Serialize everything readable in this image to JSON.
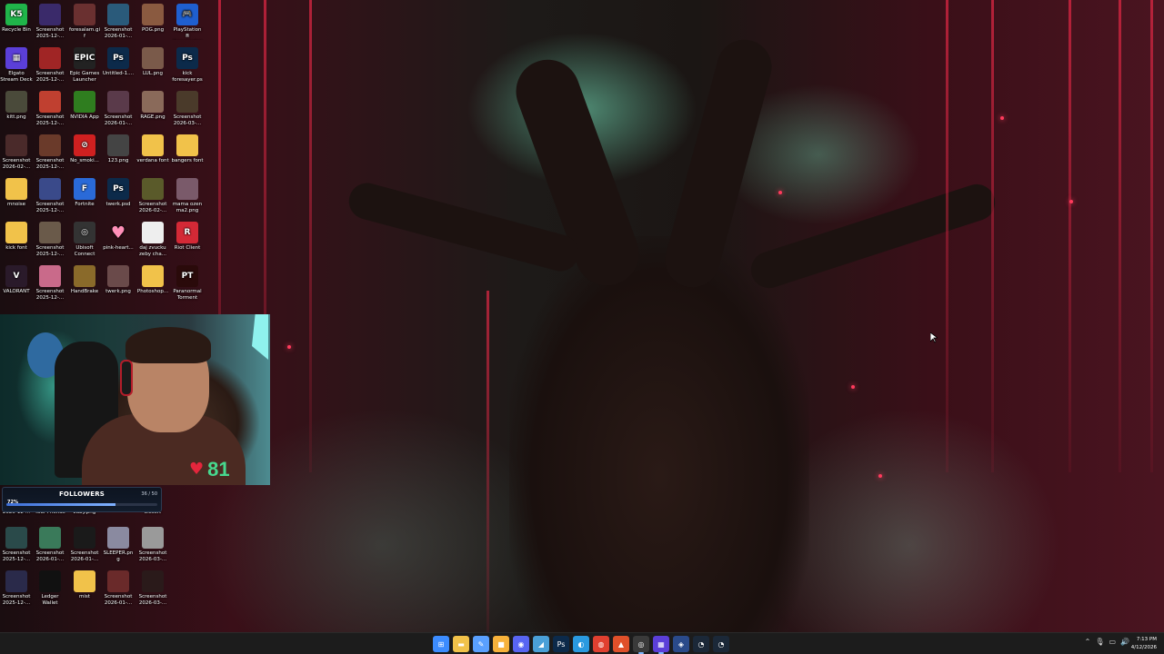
{
  "desktop": {
    "icons": [
      {
        "label": "Recycle Bin",
        "glyph": "K5",
        "color": "#20b54a",
        "icon": "recycle-bin-icon"
      },
      {
        "label": "Screenshot 2025-12-...",
        "glyph": "",
        "color": "#3a2a6a",
        "icon": "screenshot-icon"
      },
      {
        "label": "foresalam.gif",
        "glyph": "",
        "color": "#6a3030",
        "icon": "gif-file-icon"
      },
      {
        "label": "Screenshot 2026-01-...",
        "glyph": "",
        "color": "#2a5a7a",
        "icon": "screenshot-icon"
      },
      {
        "label": "POG.png",
        "glyph": "",
        "color": "#8a5a40",
        "icon": "image-file-icon"
      },
      {
        "label": "PlayStation® Accessories",
        "glyph": "🎮",
        "color": "#1f5fcf",
        "icon": "playstation-icon"
      },
      {
        "label": "Elgato Stream Deck",
        "glyph": "▦",
        "color": "#5b3fd8",
        "icon": "stream-deck-icon"
      },
      {
        "label": "Screenshot 2025-12-...",
        "glyph": "",
        "color": "#a02525",
        "icon": "screenshot-icon"
      },
      {
        "label": "Epic Games Launcher",
        "glyph": "EPIC",
        "color": "#222222",
        "icon": "epic-games-icon"
      },
      {
        "label": "Untitled-1....",
        "glyph": "Ps",
        "color": "#0c2a4a",
        "icon": "photoshop-file-icon"
      },
      {
        "label": "LUL.png",
        "glyph": "",
        "color": "#7a5a4a",
        "icon": "image-file-icon"
      },
      {
        "label": "kick foresayer.psd",
        "glyph": "Ps",
        "color": "#0c2a4a",
        "icon": "photoshop-file-icon"
      },
      {
        "label": "kitt.png",
        "glyph": "",
        "color": "#4a4a3a",
        "icon": "image-file-icon"
      },
      {
        "label": "Screenshot 2025-12-...",
        "glyph": "",
        "color": "#c04030",
        "icon": "screenshot-icon"
      },
      {
        "label": "NVIDIA App",
        "glyph": "",
        "color": "#2f7d1f",
        "icon": "nvidia-icon"
      },
      {
        "label": "Screenshot 2026-01-...",
        "glyph": "",
        "color": "#5a3a4a",
        "icon": "screenshot-icon"
      },
      {
        "label": "RAGE.png",
        "glyph": "",
        "color": "#8a6a5a",
        "icon": "image-file-icon"
      },
      {
        "label": "Screenshot 2026-03-...",
        "glyph": "",
        "color": "#4a3a2a",
        "icon": "screenshot-icon"
      },
      {
        "label": "Screenshot 2026-02-...",
        "glyph": "",
        "color": "#4a2a2a",
        "icon": "screenshot-icon"
      },
      {
        "label": "Screenshot 2025-12-...",
        "glyph": "",
        "color": "#6a3a2a",
        "icon": "screenshot-icon"
      },
      {
        "label": "No_smoki...",
        "glyph": "⊘",
        "color": "#d02020",
        "icon": "no-smoking-icon"
      },
      {
        "label": "123.png",
        "glyph": "",
        "color": "#444444",
        "icon": "image-file-icon"
      },
      {
        "label": "verdana font",
        "glyph": "",
        "color": "#f1c24a",
        "icon": "folder-icon"
      },
      {
        "label": "bangers font",
        "glyph": "",
        "color": "#f1c24a",
        "icon": "folder-icon"
      },
      {
        "label": "mnoise",
        "glyph": "",
        "color": "#f1c24a",
        "icon": "folder-icon"
      },
      {
        "label": "Screenshot 2025-12-...",
        "glyph": "",
        "color": "#3a4a8a",
        "icon": "screenshot-icon"
      },
      {
        "label": "Fortnite",
        "glyph": "F",
        "color": "#2a6ad8",
        "icon": "fortnite-icon"
      },
      {
        "label": "twerk.psd",
        "glyph": "Ps",
        "color": "#0c2a4a",
        "icon": "photoshop-file-icon"
      },
      {
        "label": "Screenshot 2026-02-...",
        "glyph": "",
        "color": "#5a5a2a",
        "icon": "screenshot-icon"
      },
      {
        "label": "mama ozen ma2.png",
        "glyph": "",
        "color": "#7a5a6a",
        "icon": "image-file-icon"
      },
      {
        "label": "kick font",
        "glyph": "",
        "color": "#f1c24a",
        "icon": "folder-icon"
      },
      {
        "label": "Screenshot 2025-12-...",
        "glyph": "",
        "color": "#6a5a4a",
        "icon": "screenshot-icon"
      },
      {
        "label": "Ubisoft Connect",
        "glyph": "◎",
        "color": "#333333",
        "icon": "ubisoft-icon"
      },
      {
        "label": "pink-heart...",
        "glyph": "♥",
        "color": "transparent",
        "icon": "pink-heart-icon"
      },
      {
        "label": "daj zvucku zeby cha...",
        "glyph": "",
        "color": "#eeeeee",
        "icon": "text-file-icon"
      },
      {
        "label": "Riot Client",
        "glyph": "R",
        "color": "#d32936",
        "icon": "riot-client-icon"
      },
      {
        "label": "VALORANT",
        "glyph": "V",
        "color": "#2a1a2a",
        "icon": "valorant-icon"
      },
      {
        "label": "Screenshot 2025-12-...",
        "glyph": "",
        "color": "#c96a8a",
        "icon": "screenshot-icon"
      },
      {
        "label": "HandBrake",
        "glyph": "",
        "color": "#8a6a2a",
        "icon": "handbrake-icon"
      },
      {
        "label": "twerk.png",
        "glyph": "",
        "color": "#6a4a4a",
        "icon": "image-file-icon"
      },
      {
        "label": "Photoshop...",
        "glyph": "",
        "color": "#f1c24a",
        "icon": "folder-icon"
      },
      {
        "label": "Paranormal Torment",
        "glyph": "PT",
        "color": "#2a0a0a",
        "icon": "game-icon"
      }
    ],
    "lower_icons": [
      {
        "label": "2025-12-...",
        "icon": "screenshot-icon",
        "color": "#3a3a3a"
      },
      {
        "label": "Your Friends",
        "icon": "image-file-icon",
        "color": "#3a3a3a"
      },
      {
        "label": "zuby.png",
        "icon": "image-file-icon",
        "color": "#3a3a3a"
      },
      {
        "label": "Desert",
        "icon": "image-file-icon",
        "color": "#3a3a3a"
      },
      {
        "label": "Screenshot 2025-12-...",
        "icon": "screenshot-icon",
        "color": "#2a4a4a"
      },
      {
        "label": "Screenshot 2026-01-...",
        "icon": "screenshot-icon",
        "color": "#3a7a5a"
      },
      {
        "label": "Screenshot 2026-01-...",
        "icon": "screenshot-icon",
        "color": "#1a1a1a"
      },
      {
        "label": "SLEEPER.png",
        "icon": "image-file-icon",
        "color": "#8a8aa0"
      },
      {
        "label": "Screenshot 2026-03-...",
        "icon": "screenshot-icon",
        "color": "#9a9a9a"
      },
      {
        "label": "Screenshot 2025-12-...",
        "icon": "screenshot-icon",
        "color": "#2a2a4a"
      },
      {
        "label": "Ledger Wallet",
        "icon": "ledger-icon",
        "color": "#111111"
      },
      {
        "label": "mist",
        "icon": "folder-icon",
        "color": "#f1c24a"
      },
      {
        "label": "Screenshot 2026-01-...",
        "icon": "screenshot-icon",
        "color": "#6a2a2a"
      },
      {
        "label": "Screenshot 2026-03-...",
        "icon": "screenshot-icon",
        "color": "#2a1a1a"
      }
    ]
  },
  "webcam": {
    "heart_value": "81",
    "heart_icon": "heart-icon"
  },
  "followers": {
    "title": "FOLLOWERS",
    "count": "36 / 50",
    "percent_label": "72%",
    "progress": 0.72
  },
  "taskbar": {
    "icons": [
      {
        "name": "start-icon",
        "glyph": "⊞",
        "color": "#3c8cff"
      },
      {
        "name": "file-explorer-icon",
        "glyph": "▬",
        "color": "#f1c24a"
      },
      {
        "name": "notepad-icon",
        "glyph": "✎",
        "color": "#5aa0ff"
      },
      {
        "name": "sticky-app-icon",
        "glyph": "■",
        "color": "#f7b23b"
      },
      {
        "name": "discord-icon",
        "glyph": "◉",
        "color": "#5865f2"
      },
      {
        "name": "app-icon",
        "glyph": "◢",
        "color": "#4aa0d8"
      },
      {
        "name": "photoshop-icon",
        "glyph": "Ps",
        "color": "#0c2a4a"
      },
      {
        "name": "edge-icon",
        "glyph": "◐",
        "color": "#2a9ae0"
      },
      {
        "name": "chrome-icon",
        "glyph": "◍",
        "color": "#e04030"
      },
      {
        "name": "brave-icon",
        "glyph": "▲",
        "color": "#e0502a"
      },
      {
        "name": "obs-icon",
        "glyph": "◎",
        "color": "#3a3a3a"
      },
      {
        "name": "stream-deck-icon",
        "glyph": "▦",
        "color": "#5b3fd8"
      },
      {
        "name": "app-icon-2",
        "glyph": "◈",
        "color": "#2a4a8a"
      },
      {
        "name": "steam-icon",
        "glyph": "◔",
        "color": "#1b2838"
      },
      {
        "name": "steam-icon-2",
        "glyph": "◔",
        "color": "#1b2838"
      }
    ],
    "tray_glyphs": [
      "⌃",
      "🎙",
      "▭",
      "🔊"
    ],
    "time": "7:13 PM",
    "date": "4/12/2026"
  }
}
